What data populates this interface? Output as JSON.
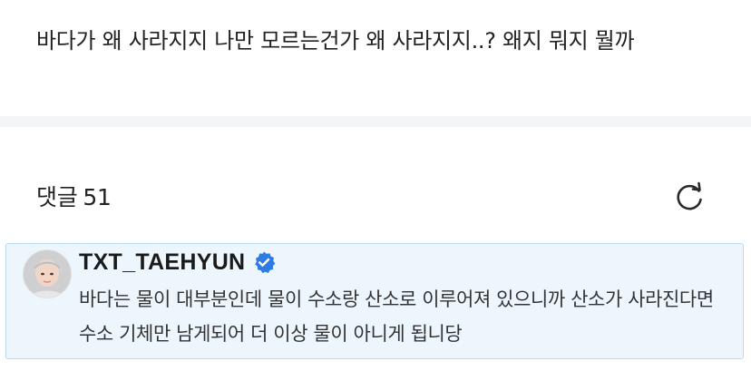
{
  "post": {
    "text": "바다가 왜 사라지지 나만 모르는건가 왜 사라지지..? 왜지 뭐지 뭘까"
  },
  "comments": {
    "label": "댓글",
    "count": "51",
    "refresh_icon": "refresh-icon"
  },
  "highlight_comment": {
    "author": "TXT_TAEHYUN",
    "verified_icon": "verified-badge-icon",
    "text": "바다는 물이 대부분인데 물이 수소랑 산소로 이루어져 있으니까 산소가 사라진다면 수소 기체만 남게되어 더 이상 물이 아니게 됩니당"
  },
  "colors": {
    "highlight_background": "#edf6fd",
    "highlight_border": "#b8daf4",
    "verified_blue": "#2e7be6",
    "divider": "#f4f5f7"
  }
}
